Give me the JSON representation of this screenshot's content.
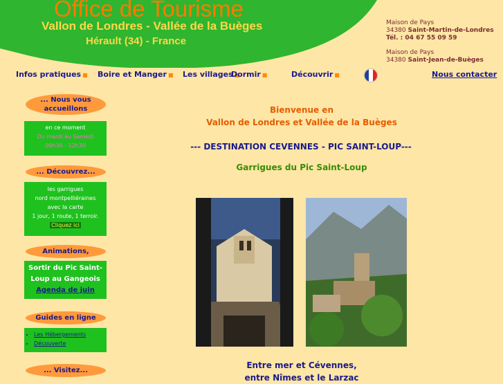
{
  "header": {
    "title": "Office de Tourisme",
    "subtitle1": "Vallon de Londres - Vallée de la Buèges",
    "subtitle2": "Hérault (34) - France",
    "address1": {
      "line1": "Maison de Pays",
      "line2_zip": "34380",
      "line2_town": "Saint-Martin-de-Londres",
      "line3": "Tél. : 04 67 55 09 59"
    },
    "address2": {
      "line1": "Maison de Pays",
      "line2_zip": "34380",
      "line2_town": "Saint-Jean-de-Buèges"
    }
  },
  "nav": {
    "items": [
      "Infos pratiques",
      "Boire et Manger",
      "Les villages",
      "Dormir",
      "Découvrir"
    ],
    "contact": "Nous contacter"
  },
  "sidebar": {
    "welcome_title": "... Nous vous accueillons",
    "welcome": {
      "line1": "en ce moment",
      "line2": "Du mardi au Samedi",
      "line3": "09h30 - 12h30"
    },
    "discover_title": "... Découvrez...",
    "discover": {
      "line1": "les garrigues",
      "line2": "nord montpelliéraines",
      "line3": "avec la carte",
      "line4": "1 jour, 1 route, 1 terroir.",
      "cta": "Cliquez ici"
    },
    "events_title": "Animations, Festivités",
    "events": {
      "line1": "Sortir du Pic Saint-",
      "line2": "Loup au Gangeois",
      "link": "Agenda de juin"
    },
    "guides_title": "Guides en ligne",
    "guides": [
      "Les Hébergements",
      "Découverte"
    ],
    "visit_title": "... Visitez..."
  },
  "main": {
    "welcome1": "Bienvenue en",
    "welcome2": "Vallon de Londres et Vallée de la Buèges",
    "destination": "--- DESTINATION CEVENNES - PIC SAINT-LOUP---",
    "garrigues": "Garrigues du Pic Saint-Loup",
    "tagline1": "Entre mer et Cévennes,",
    "tagline2": "entre Nîmes et le Larzac"
  },
  "colors": {
    "background": "#fde6a6",
    "header_green": "#2fb52f",
    "accent_orange": "#ff9a3c",
    "box_green": "#1fc11f",
    "nav_blue": "#1a1a8c"
  }
}
